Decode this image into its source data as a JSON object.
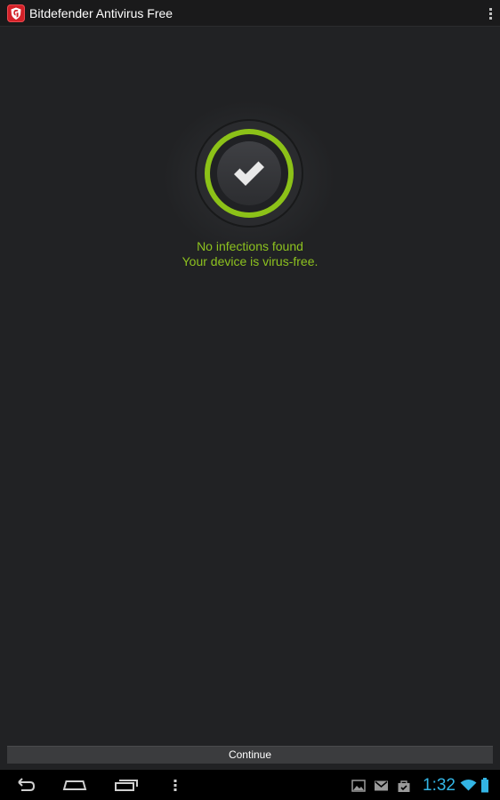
{
  "app": {
    "title": "Bitdefender Antivirus Free",
    "icon": "bitdefender-shield-icon",
    "menu_icon": "overflow-menu-icon"
  },
  "result": {
    "status_icon": "check-icon",
    "line1": "No infections found",
    "line2": "Your device is virus-free."
  },
  "actions": {
    "continue_label": "Continue"
  },
  "system_bar": {
    "clock": "1:32",
    "nav_icons": [
      "back-icon",
      "home-icon",
      "recent-apps-icon",
      "menu-dots-icon"
    ],
    "notification_icons": [
      "gallery-icon",
      "gmail-icon",
      "store-icon"
    ],
    "status_icons": [
      "wifi-icon",
      "battery-icon"
    ]
  },
  "colors": {
    "accent_green": "#8dc21f",
    "brand_red": "#d32128",
    "clock_blue": "#33b5e5",
    "background": "#212224"
  }
}
